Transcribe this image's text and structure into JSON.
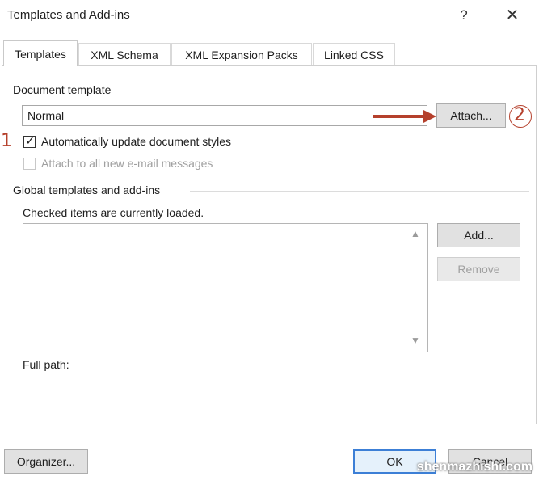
{
  "window": {
    "title": "Templates and Add-ins",
    "help_icon": "?",
    "close_icon": "✕"
  },
  "tabs": [
    {
      "label": "Templates",
      "active": true
    },
    {
      "label": "XML Schema",
      "active": false
    },
    {
      "label": "XML Expansion Packs",
      "active": false
    },
    {
      "label": "Linked CSS",
      "active": false
    }
  ],
  "document_template": {
    "group_label": "Document template",
    "value": "Normal",
    "attach_label": "Attach...",
    "auto_update_label": "Automatically update document styles",
    "auto_update_checked": true,
    "attach_email_label": "Attach to all new e-mail messages",
    "attach_email_enabled": false
  },
  "global_templates": {
    "group_label": "Global templates and add-ins",
    "hint": "Checked items are currently loaded.",
    "add_label": "Add...",
    "remove_label": "Remove",
    "full_path_label": "Full path:"
  },
  "footer": {
    "organizer_label": "Organizer...",
    "ok_label": "OK",
    "cancel_label": "Cancel"
  },
  "annotations": {
    "step1": "1",
    "step2": "2",
    "arrow_color": "#b5402c"
  },
  "watermark": "shenmazhishi.com",
  "colors": {
    "default_button_border": "#3c7fd6",
    "default_button_fill": "#e5f1fb",
    "annotation": "#b5402c"
  }
}
